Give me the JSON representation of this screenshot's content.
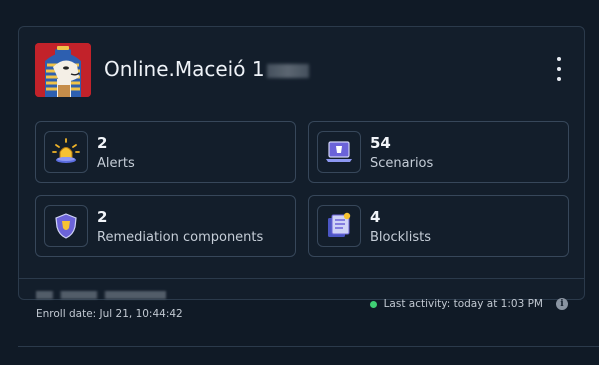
{
  "machine": {
    "name": "Online.Maceió 1",
    "avatar_icon": "pharaoh-llama-avatar"
  },
  "stats": [
    {
      "value": "2",
      "label": "Alerts",
      "icon": "alarm-light-icon"
    },
    {
      "value": "54",
      "label": "Scenarios",
      "icon": "laptop-scenario-icon"
    },
    {
      "value": "2",
      "label": "Remediation components",
      "icon": "shield-icon"
    },
    {
      "value": "4",
      "label": "Blocklists",
      "icon": "blocklist-icon"
    }
  ],
  "footer": {
    "enroll_date": "Enroll date: Jul 21, 10:44:42",
    "last_activity": "Last activity: today at 1:03 PM",
    "status_color": "#3fcf74",
    "info_glyph": "i"
  },
  "colors": {
    "background": "#101a26",
    "card": "#131e2b",
    "border": "#37475a"
  }
}
